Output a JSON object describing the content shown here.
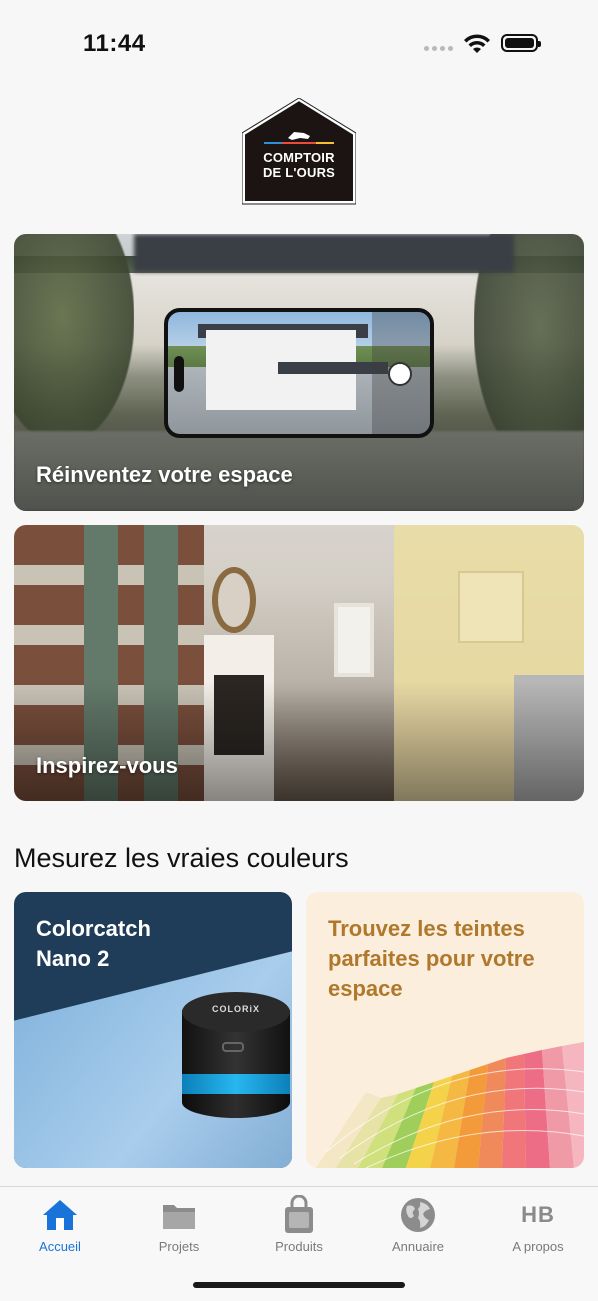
{
  "status_bar": {
    "time": "11:44"
  },
  "logo": {
    "line1": "COMPTOIR",
    "line2": "DE L'OURS"
  },
  "cards": {
    "reinvent": {
      "title": "Réinventez votre espace"
    },
    "inspire": {
      "title": "Inspirez-vous"
    }
  },
  "measure": {
    "section_title": "Mesurez les vraies couleurs",
    "colorcatch": {
      "line1": "Colorcatch",
      "line2": "Nano 2",
      "device_brand": "COLORiX"
    },
    "shades": {
      "title": "Trouvez les teintes parfaites pour votre espace"
    }
  },
  "tabbar": {
    "tabs": [
      {
        "label": "Accueil",
        "icon": "home-icon",
        "active": true
      },
      {
        "label": "Projets",
        "icon": "folder-icon",
        "active": false
      },
      {
        "label": "Produits",
        "icon": "paint-can-icon",
        "active": false
      },
      {
        "label": "Annuaire",
        "icon": "globe-icon",
        "active": false
      },
      {
        "label": "A propos",
        "icon": "hb-monogram-icon",
        "icon_text": "HB",
        "active": false
      }
    ]
  },
  "colors": {
    "accent": "#1a73d9",
    "shades_title": "#b0782a",
    "colorcatch_bg": "#1f3d58"
  }
}
